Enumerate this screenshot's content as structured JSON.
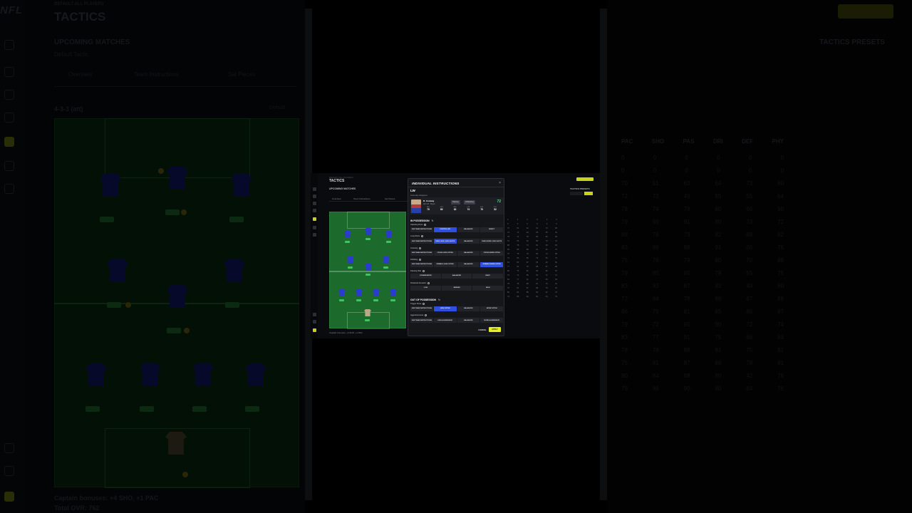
{
  "background": {
    "brand": "NFL",
    "breadcrumb": "DEFAULT ALL PLAYERS",
    "title": "TACTICS",
    "upcoming": "UPCOMING MATCHES",
    "upcoming_value": "Default Tactic",
    "tabs": [
      "Overview",
      "Team Instructions",
      "Set Pieces"
    ],
    "formation": "4-3-3 (att)",
    "formation_right": "Default",
    "chemistry_line": "Captain bonuses: +4 SHO, +1 PAC",
    "total_ovr": "Total OVR: 762",
    "pitch_snapshot": "Pitch Support",
    "presets_title": "TACTICS PRESETS",
    "stat_headers": [
      "PAC",
      "SHO",
      "PAS",
      "DRI",
      "DEF",
      "PHY"
    ],
    "stat_rows": [
      [
        "0",
        "0",
        "0",
        "0",
        "0",
        "0"
      ],
      [
        "0",
        "0",
        "0",
        "0",
        "0",
        "0"
      ],
      [
        "70",
        "51",
        "62",
        "64",
        "73",
        "80"
      ],
      [
        "72",
        "73",
        "49",
        "65",
        "55",
        "64"
      ],
      [
        "78",
        "74",
        "78",
        "80",
        "66",
        "90"
      ],
      [
        "79",
        "66",
        "91",
        "80",
        "73",
        "72"
      ],
      [
        "88",
        "78",
        "73",
        "82",
        "68",
        "82"
      ],
      [
        "83",
        "86",
        "88",
        "91",
        "66",
        "76"
      ],
      [
        "75",
        "78",
        "79",
        "80",
        "70",
        "88"
      ],
      [
        "79",
        "85",
        "85",
        "79",
        "55",
        "75"
      ],
      [
        "83",
        "83",
        "87",
        "83",
        "49",
        "80"
      ],
      [
        "77",
        "84",
        "78",
        "88",
        "87",
        "88"
      ],
      [
        "86",
        "75",
        "81",
        "85",
        "86",
        "87"
      ],
      [
        "79",
        "72",
        "85",
        "90",
        "72",
        "74"
      ],
      [
        "83",
        "77",
        "91",
        "75",
        "66",
        "83"
      ],
      [
        "78",
        "78",
        "88",
        "81",
        "75",
        "81"
      ],
      [
        "75",
        "81",
        "87",
        "88",
        "78",
        "81"
      ],
      [
        "80",
        "84",
        "88",
        "80",
        "42",
        "76"
      ],
      [
        "79",
        "88",
        "90",
        "80",
        "64",
        "76"
      ]
    ]
  },
  "modal": {
    "title": "INDIVIDUAL INSTRUCTIONS",
    "close_icon": "×",
    "position": "LW",
    "assigned_label": "Currently Assigned",
    "player": {
      "name": "R. Conway",
      "meta": "LW, LM  ·  Skyes",
      "tags": [
        "Passing",
        "Unblocking"
      ],
      "ovr": "72",
      "stats": [
        {
          "k": "PAC",
          "v": "75"
        },
        {
          "k": "SHO",
          "v": "80"
        },
        {
          "k": "PAS",
          "v": "82"
        },
        {
          "k": "DRI",
          "v": "74"
        },
        {
          "k": "DEF",
          "v": "70"
        },
        {
          "k": "PHY",
          "v": "52"
        }
      ]
    },
    "in_possession": {
      "title": "IN POSSESSION",
      "rows": [
        {
          "label": "Attacking Runs",
          "options": [
            "USE TEAM INSTRUCTIONS",
            "CONTROLLED",
            "BALANCED",
            "DIRECT"
          ],
          "selected": 1
        },
        {
          "label": "Long Shots",
          "options": [
            "USE TEAM INSTRUCTIONS",
            "TAKE LESS LONG SHOTS",
            "BALANCED",
            "TAKE MORE LONG SHOTS"
          ],
          "selected": 1
        },
        {
          "label": "Crossing",
          "options": [
            "USE TEAM INSTRUCTIONS",
            "CROSS LESS OFTEN",
            "BALANCED",
            "CROSS MORE OFTEN"
          ],
          "selected": -1
        },
        {
          "label": "Dribbling",
          "options": [
            "USE TEAM INSTRUCTIONS",
            "DRIBBLE LESS OFTEN",
            "BALANCED",
            "DRIBBLE MORE OFTEN"
          ],
          "selected": 3
        },
        {
          "label": "Passing Risk",
          "options": [
            "CONSERVATIVE",
            "BALANCED",
            "RISKY"
          ],
          "selected": -1
        },
        {
          "label": "Positional Freedom",
          "options": [
            "LOW",
            "MEDIUM",
            "HIGH"
          ],
          "selected": -1
        }
      ]
    },
    "out_of_possession": {
      "title": "OUT OF POSSESSION",
      "rows": [
        {
          "label": "Trigger Press",
          "options": [
            "USE TEAM INSTRUCTIONS",
            "LESS OFTEN",
            "BALANCED",
            "MORE OFTEN"
          ],
          "selected": 1
        },
        {
          "label": "Aggressiveness",
          "options": [
            "USE TEAM INSTRUCTIONS",
            "LESS AGGRESSIVE",
            "BALANCED",
            "MORE AGGRESSIVE"
          ],
          "selected": -1
        }
      ]
    },
    "cancel": "CANCEL",
    "apply": "APPLY"
  }
}
